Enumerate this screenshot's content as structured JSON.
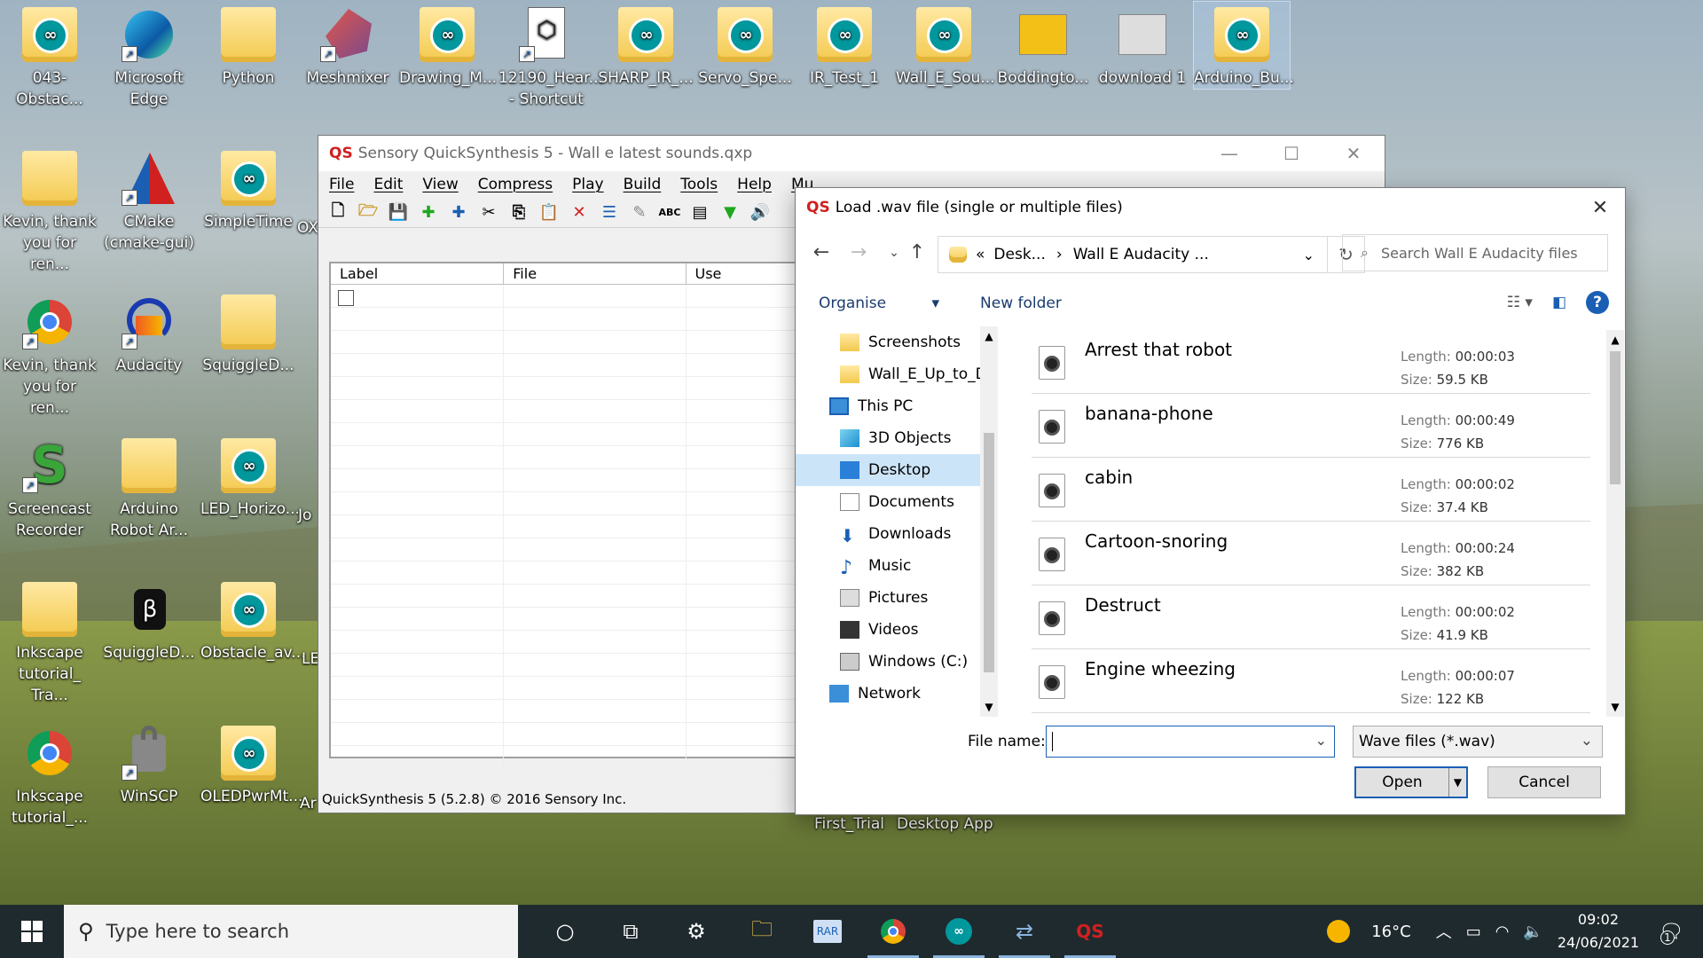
{
  "desktop": {
    "icons": [
      {
        "label": "043-Obstac...",
        "kind": "arduino"
      },
      {
        "label": "Microsoft Edge",
        "kind": "edge"
      },
      {
        "label": "Python",
        "kind": "folder"
      },
      {
        "label": "Meshmixer",
        "kind": "meshmixer"
      },
      {
        "label": "Drawing_M...",
        "kind": "arduino"
      },
      {
        "label": "12190_Hear... - Shortcut",
        "kind": "shortcut-doc"
      },
      {
        "label": "SHARP_IR_...",
        "kind": "arduino"
      },
      {
        "label": "Servo_Spe...",
        "kind": "arduino"
      },
      {
        "label": "IR_Test_1",
        "kind": "arduino"
      },
      {
        "label": "Wall_E_Sou...",
        "kind": "arduino"
      },
      {
        "label": "Boddingto...",
        "kind": "image"
      },
      {
        "label": "download 1",
        "kind": "image"
      },
      {
        "label": "Arduino_Bu...",
        "kind": "arduino"
      },
      {
        "label": "Kevin, thank you for ren...",
        "kind": "folder"
      },
      {
        "label": "CMake (cmake-gui)",
        "kind": "cmake"
      },
      {
        "label": "SimpleTime",
        "kind": "arduino"
      },
      {
        "label": "Kevin, thank you for ren...",
        "kind": "chrome"
      },
      {
        "label": "Audacity",
        "kind": "audacity"
      },
      {
        "label": "SquiggleD...",
        "kind": "folder"
      },
      {
        "label": "Screencast Recorder",
        "kind": "screencast"
      },
      {
        "label": "Arduino Robot Ar...",
        "kind": "folder"
      },
      {
        "label": "LED_Horizo...",
        "kind": "arduino"
      },
      {
        "label": "Inkscape tutorial_ Tra...",
        "kind": "folder"
      },
      {
        "label": "SquiggleD...",
        "kind": "bit"
      },
      {
        "label": "Obstacle_av...",
        "kind": "arduino"
      },
      {
        "label": "Inkscape tutorial_...",
        "kind": "chrome"
      },
      {
        "label": "WinSCP",
        "kind": "winscp"
      },
      {
        "label": "OLEDPwrMt...",
        "kind": "arduino"
      }
    ],
    "partial_labels": [
      "OX",
      "Jo",
      "LE",
      "Ar"
    ],
    "bg_labels": [
      "First_Trial",
      "Desktop App"
    ]
  },
  "app": {
    "title": "Sensory QuickSynthesis 5 - Wall e latest sounds.qxp",
    "logo": "QS",
    "menu": [
      "File",
      "Edit",
      "View",
      "Compress",
      "Play",
      "Build",
      "Tools",
      "Help",
      "Mu"
    ],
    "list_headers": [
      "Label",
      "File",
      "Use"
    ],
    "status": "QuickSynthesis 5 (5.2.8) © 2016 Sensory Inc."
  },
  "dialog": {
    "title": "Load .wav file (single or multiple files)",
    "address": {
      "prefix": "«",
      "crumb1": "Desk...",
      "sep": "›",
      "crumb2": "Wall E Audacity ..."
    },
    "search_placeholder": "Search Wall E Audacity files",
    "organise": "Organise",
    "new_folder": "New folder",
    "tree": [
      {
        "label": "Screenshots",
        "icon": "folder"
      },
      {
        "label": "Wall_E_Up_to_Da",
        "icon": "folder"
      },
      {
        "label": "This PC",
        "icon": "pc"
      },
      {
        "label": "3D Objects",
        "icon": "3d"
      },
      {
        "label": "Desktop",
        "icon": "desktop",
        "selected": true
      },
      {
        "label": "Documents",
        "icon": "docs"
      },
      {
        "label": "Downloads",
        "icon": "downloads"
      },
      {
        "label": "Music",
        "icon": "music"
      },
      {
        "label": "Pictures",
        "icon": "pictures"
      },
      {
        "label": "Videos",
        "icon": "videos"
      },
      {
        "label": "Windows (C:)",
        "icon": "drive"
      },
      {
        "label": "Network",
        "icon": "network"
      }
    ],
    "files": [
      {
        "name": "Arrest that robot",
        "length": "00:00:03",
        "size": "59.5 KB"
      },
      {
        "name": "banana-phone",
        "length": "00:00:49",
        "size": "776 KB"
      },
      {
        "name": "cabin",
        "length": "00:00:02",
        "size": "37.4 KB"
      },
      {
        "name": "Cartoon-snoring",
        "length": "00:00:24",
        "size": "382 KB"
      },
      {
        "name": "Destruct",
        "length": "00:00:02",
        "size": "41.9 KB"
      },
      {
        "name": "Engine wheezing",
        "length": "00:00:07",
        "size": "122 KB"
      }
    ],
    "length_label": "Length:",
    "size_label": "Size:",
    "file_name_label": "File name:",
    "file_name_value": "",
    "file_type": "Wave files (*.wav)",
    "open": "Open",
    "cancel": "Cancel"
  },
  "taskbar": {
    "search_placeholder": "Type here to search",
    "temperature": "16°C",
    "time": "09:02",
    "date": "24/06/2021",
    "notification_count": "1",
    "colors": {
      "bg": "#1f2a2e",
      "accent": "#1a5fb4"
    }
  }
}
